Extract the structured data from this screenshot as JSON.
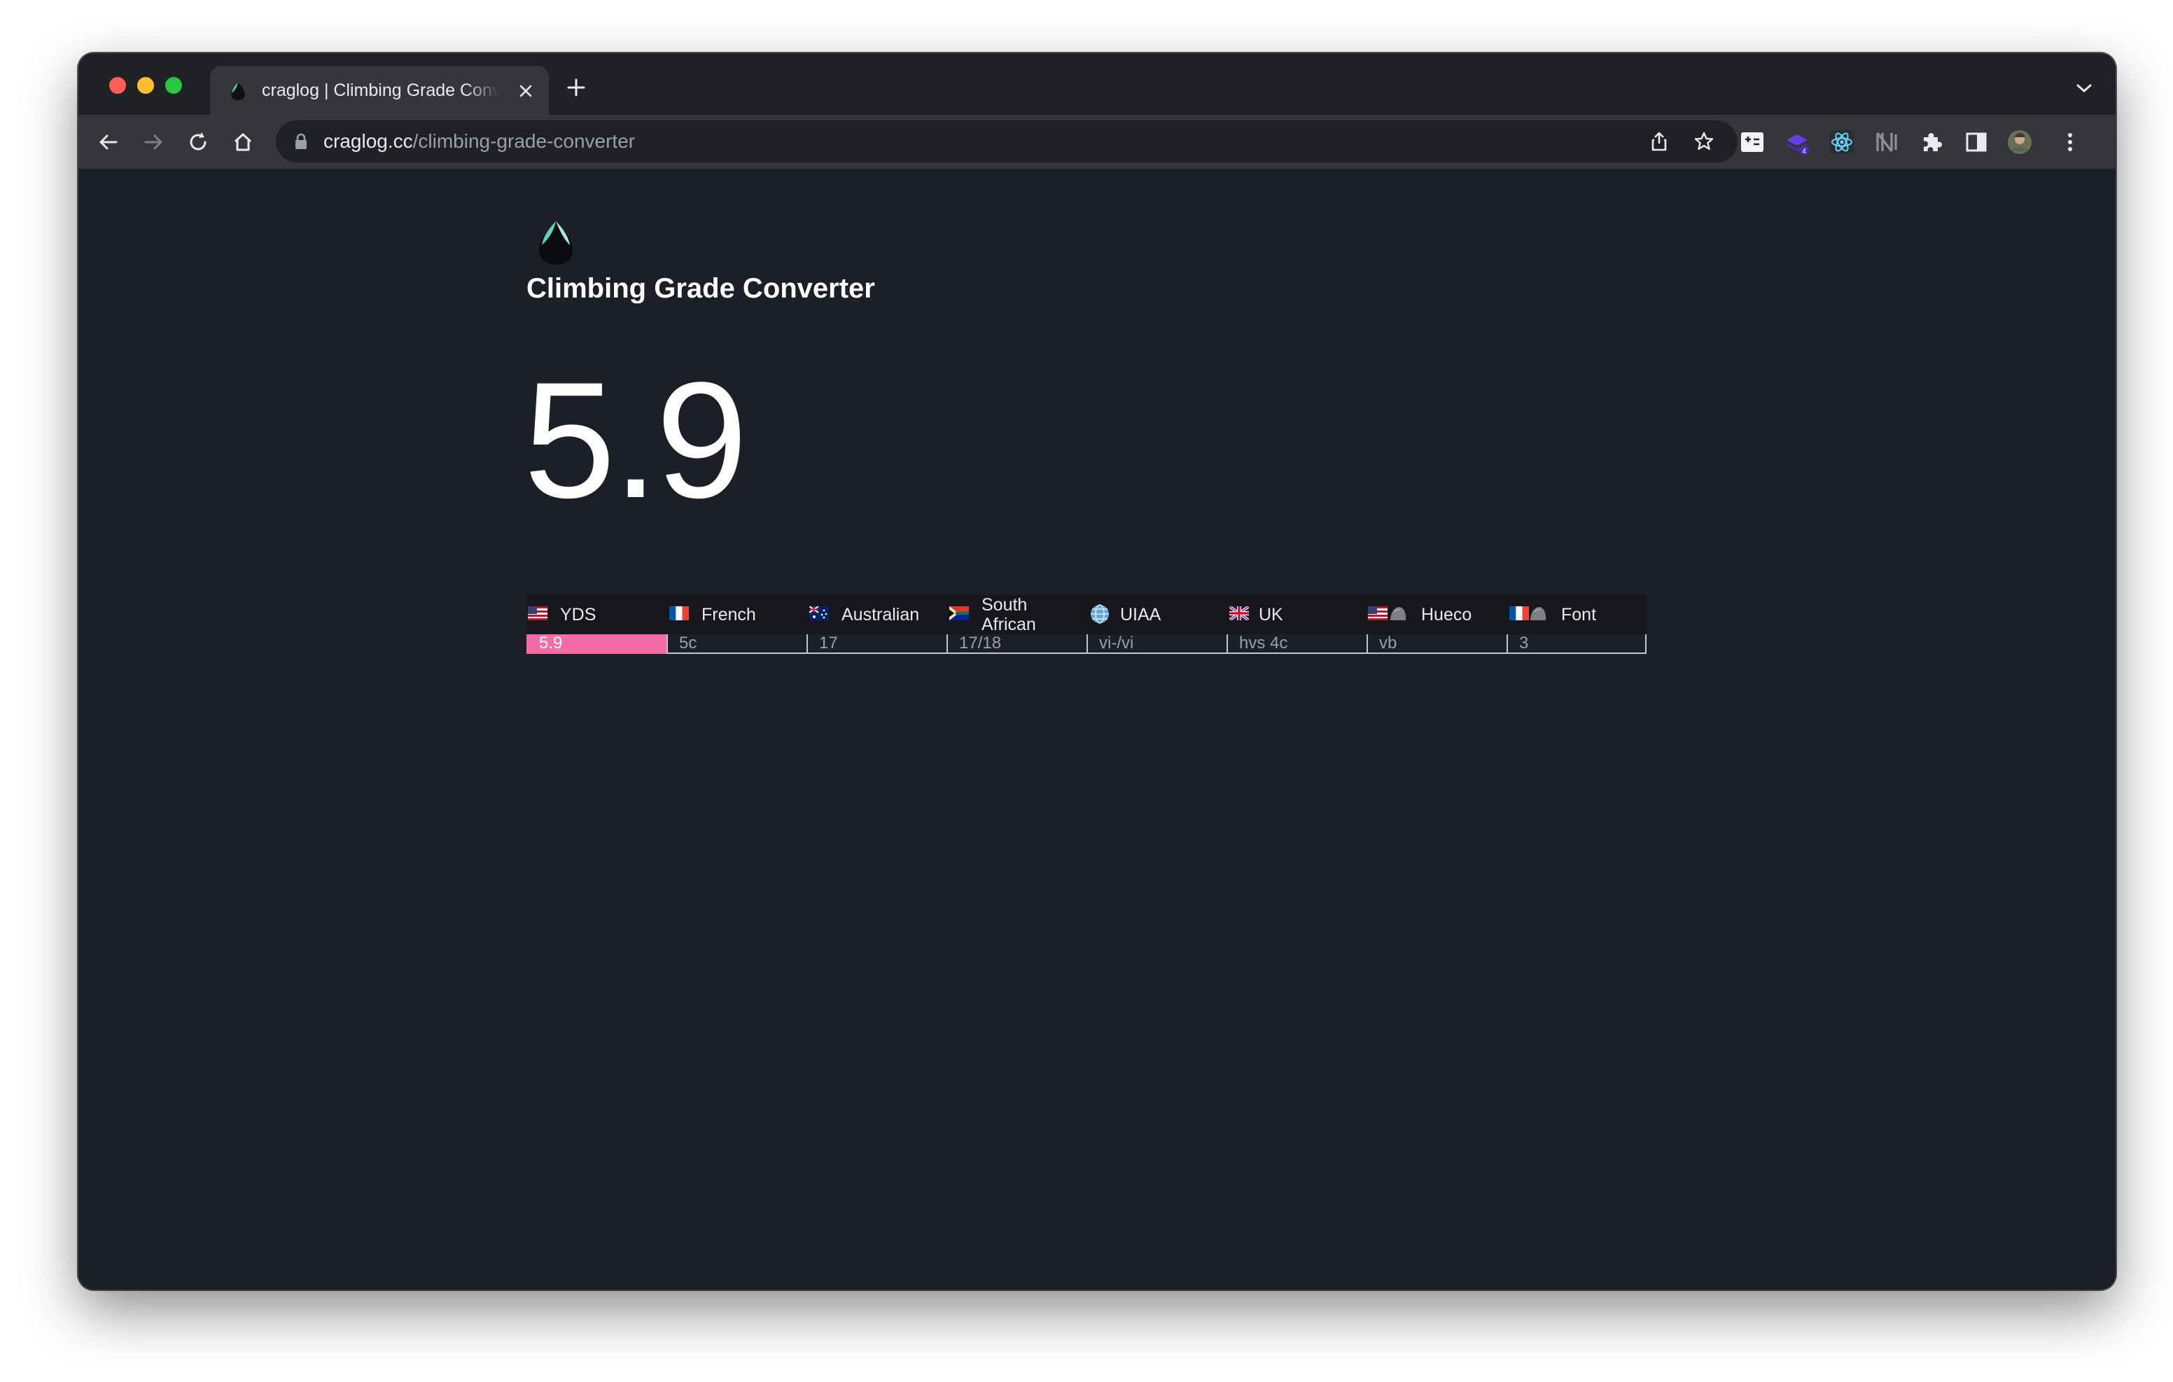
{
  "browser": {
    "tab": {
      "title": "craglog | Climbing Grade Converter"
    },
    "address": {
      "host": "craglog.cc",
      "path": "/climbing-grade-converter"
    },
    "extensions": {
      "badge_count": "4"
    }
  },
  "page": {
    "title": "Climbing Grade Converter",
    "selected_grade": "5.9",
    "accent_color": "#f26da8",
    "systems": [
      {
        "name": "YDS",
        "grade": "5.9",
        "flag": "us-flag",
        "selected": true
      },
      {
        "name": "French",
        "grade": "5c",
        "flag": "fr-flag"
      },
      {
        "name": "Australian",
        "grade": "17",
        "flag": "au-flag"
      },
      {
        "name": "South African",
        "grade": "17/18",
        "flag": "za-flag"
      },
      {
        "name": "UIAA",
        "grade": "vi-/vi",
        "flag": "globe-icon"
      },
      {
        "name": "UK",
        "grade": "hvs 4c",
        "flag": "uk-flag"
      },
      {
        "name": "Hueco",
        "grade": "vb",
        "flag": "us-flag",
        "extra_icon": "boulder-icon"
      },
      {
        "name": "Font",
        "grade": "3",
        "flag": "fr-flag",
        "extra_icon": "boulder-icon"
      }
    ]
  }
}
